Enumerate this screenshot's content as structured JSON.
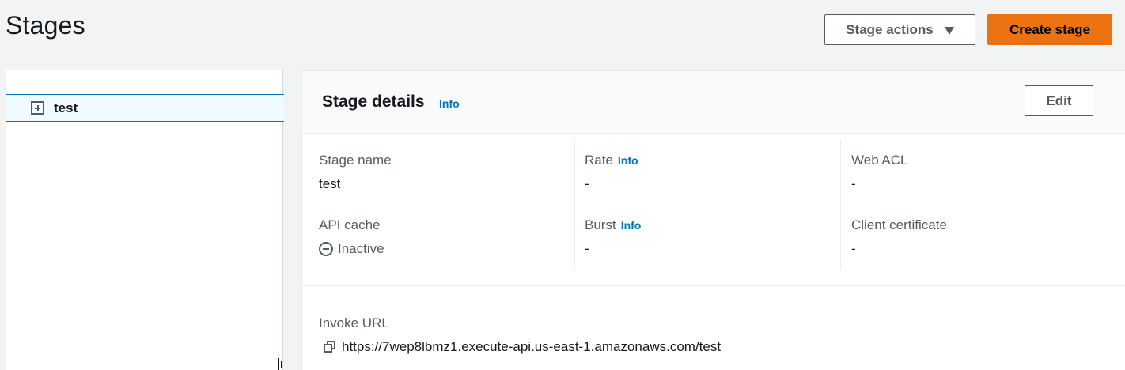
{
  "header": {
    "title": "Stages",
    "stage_actions_label": "Stage actions",
    "create_stage_label": "Create stage"
  },
  "tree": {
    "items": [
      {
        "label": "test",
        "selected": true,
        "icon": "expand-plus-icon"
      }
    ]
  },
  "details": {
    "title": "Stage details",
    "info_label": "Info",
    "edit_label": "Edit",
    "fields": {
      "stage_name": {
        "label": "Stage name",
        "value": "test"
      },
      "rate": {
        "label": "Rate",
        "info": "Info",
        "value": "-"
      },
      "web_acl": {
        "label": "Web ACL",
        "value": "-"
      },
      "api_cache": {
        "label": "API cache",
        "value": "Inactive",
        "icon": "inactive-icon"
      },
      "burst": {
        "label": "Burst",
        "info": "Info",
        "value": "-"
      },
      "client_certificate": {
        "label": "Client certificate",
        "value": "-"
      }
    },
    "invoke_url": {
      "label": "Invoke URL",
      "value": "https://7wep8lbmz1.execute-api.us-east-1.amazonaws.com/test",
      "icon": "copy-icon"
    }
  },
  "colors": {
    "page_bg": "#f2f3f3",
    "primary_button": "#ec7211",
    "link": "#0073bb",
    "selected_row_bg": "#f1faff",
    "selected_row_border": "#0073bb"
  }
}
